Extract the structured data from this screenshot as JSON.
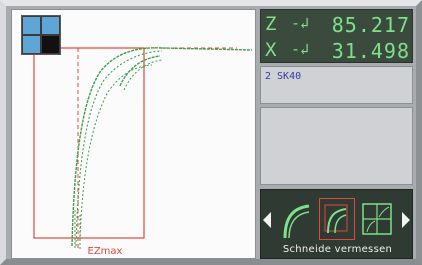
{
  "plot": {
    "limit_label": "EZmax",
    "zoom_icon": "zoom-grid-icon"
  },
  "coords": {
    "z_label": "Z",
    "z_symbol": "-↲",
    "z_value": "85.217",
    "x_label": "X",
    "x_symbol": "-↲",
    "x_value": "31.498"
  },
  "tool": {
    "text": "2  SK40"
  },
  "softkeys": {
    "label": "Schneide vermessen",
    "keys": [
      "tool-edge-icon",
      "measure-tool-icon",
      "grid-view-icon"
    ]
  },
  "colors": {
    "curve": "#3f9e4a",
    "limit": "#e0473f",
    "display_green": "#7fe08a"
  }
}
